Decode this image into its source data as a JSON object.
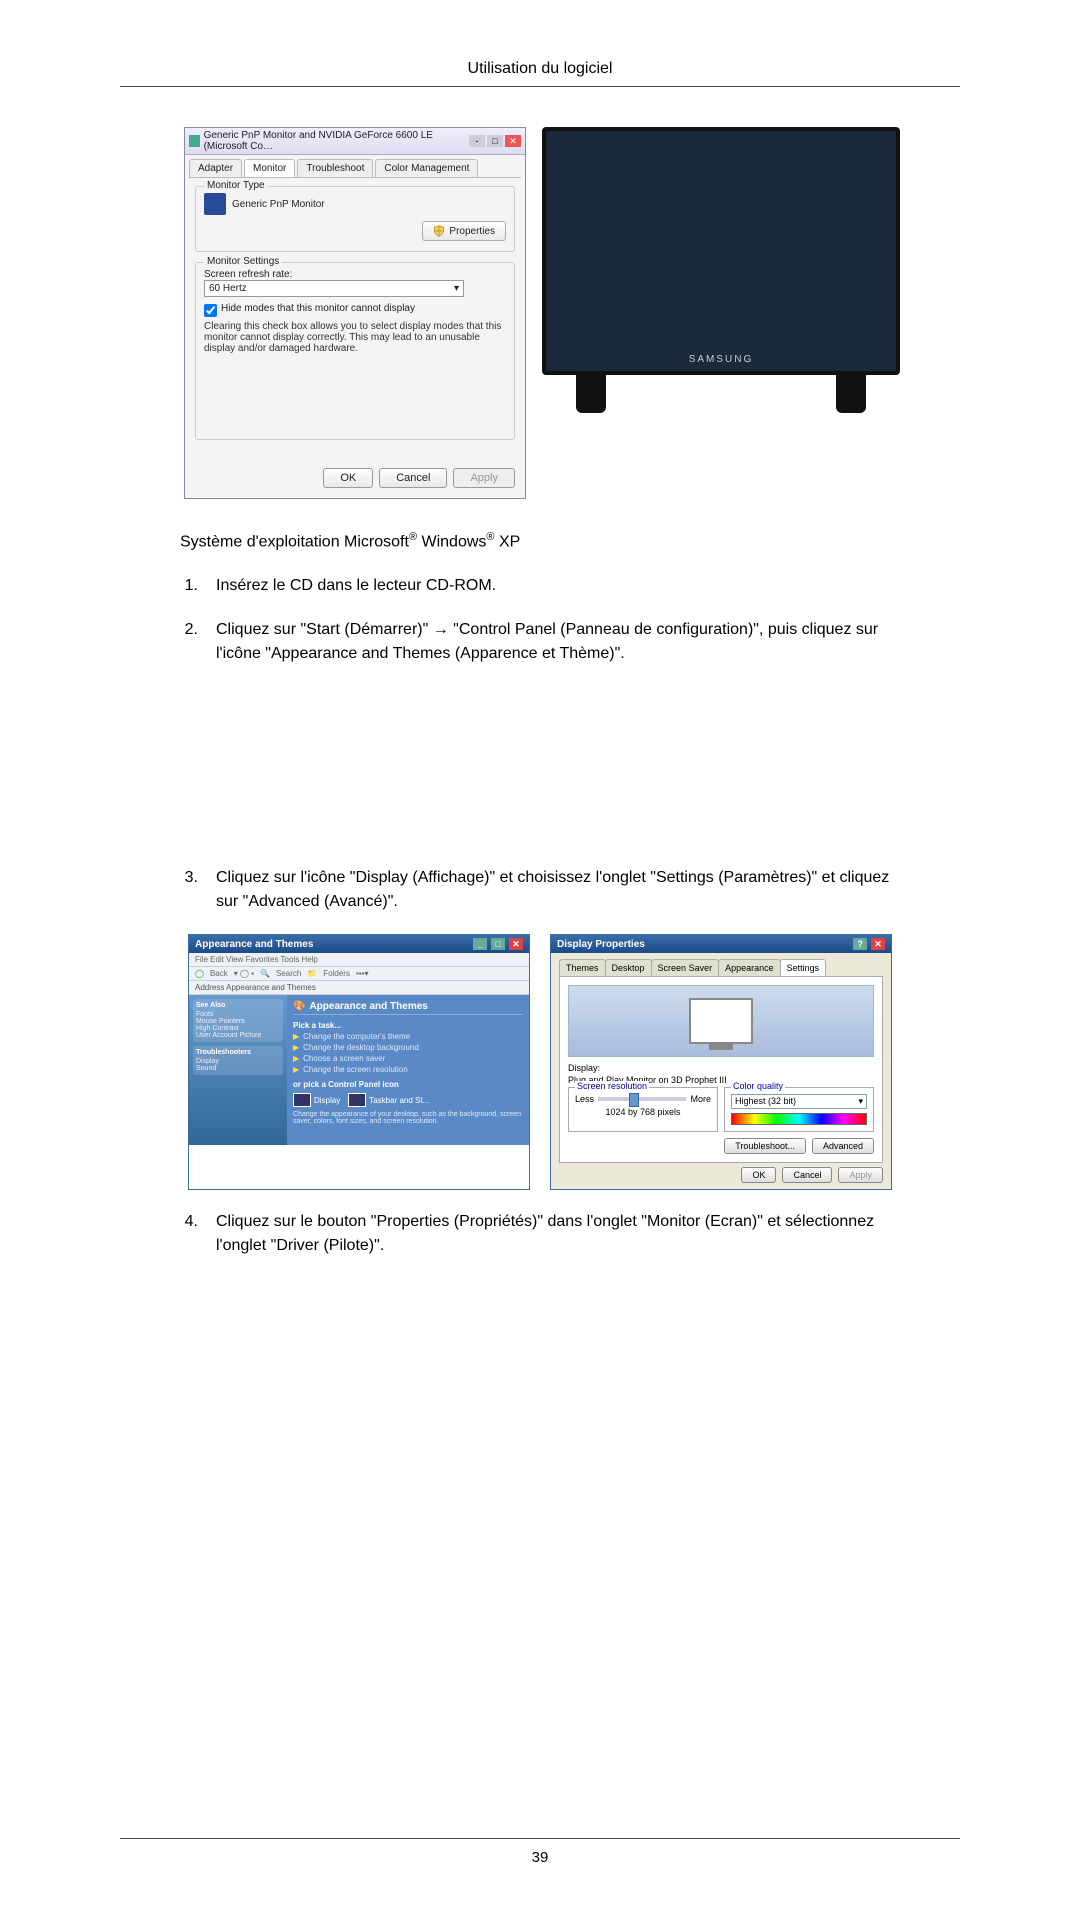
{
  "header": "Utilisation du logiciel",
  "page_number": "39",
  "dialog1": {
    "title": "Generic PnP Monitor and NVIDIA GeForce 6600 LE (Microsoft Co…",
    "tabs": [
      "Adapter",
      "Monitor",
      "Troubleshoot",
      "Color Management"
    ],
    "active_tab": 1,
    "group1_legend": "Monitor Type",
    "monitor_name": "Generic PnP Monitor",
    "properties_btn": "Properties",
    "group2_legend": "Monitor Settings",
    "refresh_label": "Screen refresh rate:",
    "refresh_value": "60 Hertz",
    "hide_modes": "Hide modes that this monitor cannot display",
    "clearing_note": "Clearing this check box allows you to select display modes that this monitor cannot display correctly. This may lead to an unusable display and/or damaged hardware.",
    "ok": "OK",
    "cancel": "Cancel",
    "apply": "Apply"
  },
  "monitor_brand": "SAMSUNG",
  "intro_line_pre": "Système d'exploitation Microsoft",
  "intro_line_mid": " Windows",
  "intro_line_post": " XP",
  "reg": "®",
  "steps": {
    "n1": "1.",
    "t1": "Insérez le CD dans le lecteur CD‐ROM.",
    "n2": "2.",
    "t2": "Cliquez sur \"Start (Démarrer)\" → \"Control Panel (Panneau de configuration)\", puis cliquez sur l'icône \"Appearance and Themes (Apparence et Thème)\".",
    "n3": "3.",
    "t3": "Cliquez sur l'icône \"Display (Affichage)\" et choisissez l'onglet \"Settings (Paramètres)\" et cliquez sur \"Advanced (Avancé)\".",
    "n4": "4.",
    "t4": "Cliquez sur le bouton \"Properties (Propriétés)\" dans l'onglet \"Monitor (Ecran)\" et sélectionnez l'onglet \"Driver (Pilote)\"."
  },
  "xp1": {
    "title": "Appearance and Themes",
    "menu": "File  Edit  View  Favorites  Tools  Help",
    "back": "Back",
    "search": "Search",
    "folders": "Folders",
    "addr": "Address   Appearance and Themes",
    "side_block1_title": "See Also",
    "side_items1": [
      "Fonts",
      "Mouse Pointers",
      "High Contrast",
      "User Account Picture"
    ],
    "side_block2_title": "Troubleshooters",
    "side_items2": [
      "Display",
      "Sound"
    ],
    "main_head": "Appearance and Themes",
    "pick_task": "Pick a task...",
    "tasks": [
      "Change the computer's theme",
      "Change the desktop background",
      "Choose a screen saver",
      "Change the screen resolution"
    ],
    "or_pick": "or pick a Control Panel icon",
    "icons": [
      "Display",
      "Taskbar and St..."
    ],
    "small_note": "Change the appearance of your desktop, such as the background, screen saver, colors, font sizes, and screen resolution."
  },
  "xp2": {
    "title": "Display Properties",
    "tabs": [
      "Themes",
      "Desktop",
      "Screen Saver",
      "Appearance",
      "Settings"
    ],
    "display_label": "Display:",
    "display_value": "Plug and Play Monitor on 3D Prophet III",
    "res_label": "Screen resolution",
    "less": "Less",
    "more": "More",
    "res_value": "1024 by 768 pixels",
    "cq_label": "Color quality",
    "cq_value": "Highest (32 bit)",
    "troubleshoot": "Troubleshoot...",
    "advanced": "Advanced",
    "ok": "OK",
    "cancel": "Cancel",
    "apply": "Apply"
  }
}
